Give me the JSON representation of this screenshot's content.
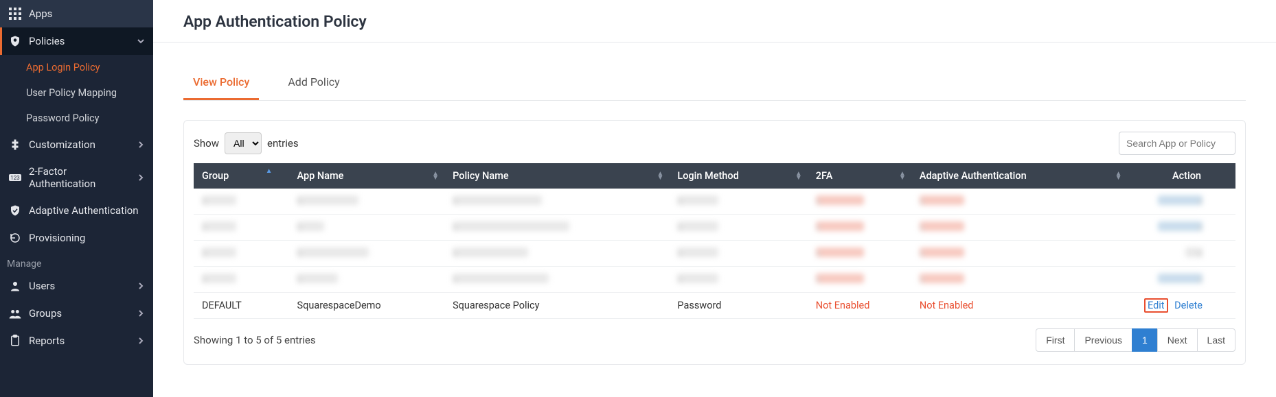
{
  "sidebar": {
    "items": [
      {
        "label": "Apps"
      },
      {
        "label": "Policies"
      },
      {
        "label": "Customization"
      },
      {
        "label": "2-Factor Authentication"
      },
      {
        "label": "Adaptive Authentication"
      },
      {
        "label": "Provisioning"
      }
    ],
    "policies_sub": [
      {
        "label": "App Login Policy"
      },
      {
        "label": "User Policy Mapping"
      },
      {
        "label": "Password Policy"
      }
    ],
    "manage_label": "Manage",
    "manage_items": [
      {
        "label": "Users"
      },
      {
        "label": "Groups"
      },
      {
        "label": "Reports"
      }
    ]
  },
  "page": {
    "title": "App Authentication Policy"
  },
  "tabs": {
    "view": "View Policy",
    "add": "Add Policy"
  },
  "tableTop": {
    "show": "Show",
    "all": "All",
    "entries": "entries",
    "search_placeholder": "Search App or Policy"
  },
  "columns": {
    "group": "Group",
    "app": "App Name",
    "policy": "Policy Name",
    "login": "Login Method",
    "tfa": "2FA",
    "adaptive": "Adaptive Authentication",
    "action": "Action"
  },
  "row": {
    "group": "DEFAULT",
    "app": "SquarespaceDemo",
    "policy": "Squarespace Policy",
    "login": "Password",
    "tfa": "Not Enabled",
    "adaptive": "Not Enabled",
    "edit": "Edit",
    "delete": "Delete"
  },
  "footer": {
    "info": "Showing 1 to 5 of 5 entries",
    "first": "First",
    "prev": "Previous",
    "page1": "1",
    "next": "Next",
    "last": "Last"
  }
}
